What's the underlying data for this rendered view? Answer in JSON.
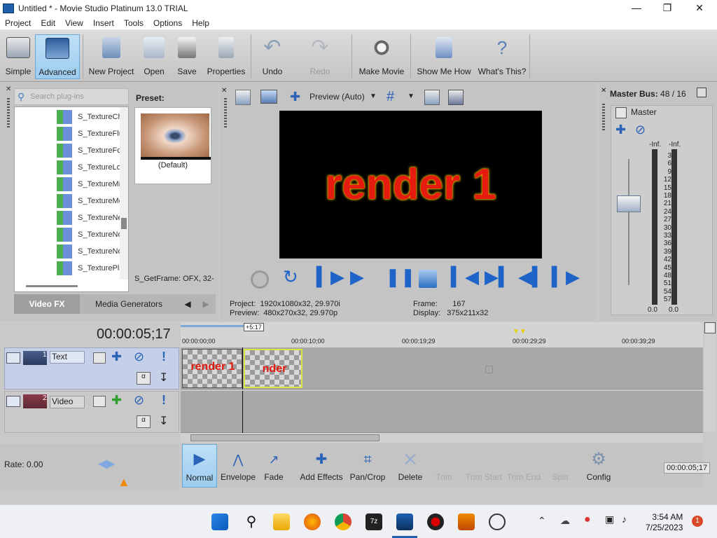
{
  "window": {
    "title": "Untitled * - Movie Studio Platinum 13.0 TRIAL"
  },
  "menu": [
    "Project",
    "Edit",
    "View",
    "Insert",
    "Tools",
    "Options",
    "Help"
  ],
  "toolbar": {
    "simple": "Simple",
    "advanced": "Advanced",
    "new_project": "New Project",
    "open": "Open",
    "save": "Save",
    "properties": "Properties",
    "undo": "Undo",
    "redo": "Redo",
    "make_movie": "Make Movie",
    "show_me_how": "Show Me How",
    "whats_this": "What's This?"
  },
  "plugins": {
    "search_placeholder": "Search plug-ins",
    "preset_label": "Preset:",
    "preset_default": "(Default)",
    "getframe": "S_GetFrame: OFX, 32-",
    "items": [
      "S_TextureCh",
      "S_TextureFlu",
      "S_TextureFo",
      "S_TextureLo",
      "S_TextureMi",
      "S_TextureMo",
      "S_TextureNe",
      "S_TextureNo",
      "S_TextureNo",
      "S_TexturePla"
    ],
    "tabs": [
      "Video FX",
      "Media Generators"
    ]
  },
  "preview": {
    "mode": "Preview (Auto)",
    "frame_text": "render 1",
    "project_label": "Project:",
    "project_value": "1920x1080x32, 29.970i",
    "preview_label": "Preview:",
    "preview_value": "480x270x32, 29.970p",
    "frame_label": "Frame:",
    "frame_value": "167",
    "display_label": "Display:",
    "display_value": "375x211x32"
  },
  "master": {
    "label": "Master Bus:",
    "value": "48 / 16",
    "name": "Master",
    "inf_left": "-Inf.",
    "inf_right": "-Inf.",
    "scale": [
      "3",
      "6",
      "9",
      "12",
      "15",
      "18",
      "21",
      "24",
      "27",
      "30",
      "33",
      "36",
      "39",
      "42",
      "45",
      "48",
      "51",
      "54",
      "57"
    ],
    "bottom_left": "0.0",
    "bottom_right": "0.0"
  },
  "timeline": {
    "timecode": "00:00:05;17",
    "cursor_tag": "+5:17",
    "ruler": [
      "00:00:00;00",
      "00:00:10;00",
      "00:00:19;29",
      "00:00:29;29",
      "00:00:39;29"
    ],
    "tracks": [
      {
        "num": "1",
        "name": "Text",
        "clip_text": "render 1",
        "clip_text2": "nder"
      },
      {
        "num": "2",
        "name": "Video"
      }
    ],
    "rate": "Rate: 0.00"
  },
  "edit_tools": {
    "normal": "Normal",
    "envelope": "Envelope",
    "fade": "Fade",
    "add_effects": "Add Effects",
    "pan_crop": "Pan/Crop",
    "delete": "Delete",
    "trim": "Trim",
    "trim_start": "Trim Start",
    "trim_end": "Trim End",
    "split": "Split",
    "config": "Config",
    "end_time": "00:00:05;17"
  },
  "taskbar": {
    "time": "3:54 AM",
    "date": "7/25/2023",
    "notify": "1"
  }
}
